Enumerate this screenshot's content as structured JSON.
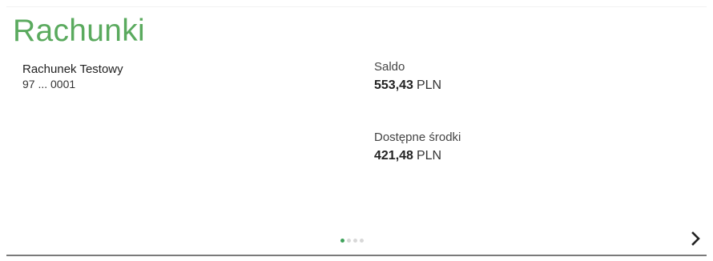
{
  "section": {
    "title": "Rachunki"
  },
  "account": {
    "name": "Rachunek Testowy",
    "number": "97 ... 0001"
  },
  "balance": {
    "label": "Saldo",
    "amount": "553,43",
    "currency": "PLN"
  },
  "available": {
    "label": "Dostępne środki",
    "amount": "421,48",
    "currency": "PLN"
  },
  "pager": {
    "total": 4,
    "active_index": 0
  },
  "icons": {
    "next": "chevron-right-icon"
  },
  "colors": {
    "title": "#5aaa5e",
    "active_dot": "#3ea25a",
    "inactive_dot": "#d8d8d8"
  }
}
